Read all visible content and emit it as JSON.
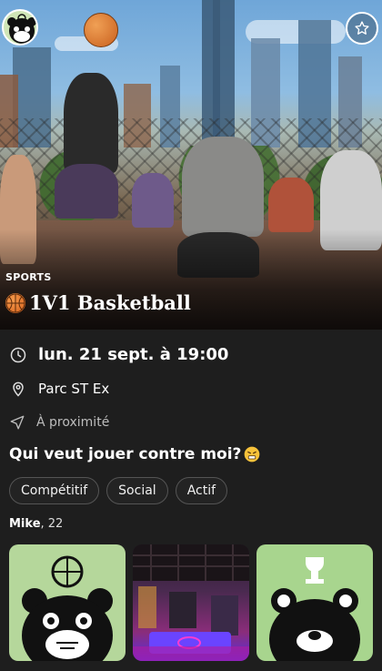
{
  "event": {
    "category": "SPORTS",
    "title": "1V1 Basketball",
    "date": "lun. 21 sept. à 19:00",
    "location": "Parc ST Ex",
    "proximity": "À proximité",
    "question": "Qui veut jouer contre moi?",
    "tags": [
      "Compétitif",
      "Social",
      "Actif"
    ]
  },
  "host": {
    "name": "Mike",
    "age": ", 22"
  },
  "icons": {
    "avatar": "bear-avatar-icon",
    "favorite": "star-icon",
    "date": "clock-icon",
    "location": "map-pin-icon",
    "proximity": "navigation-arrow-icon",
    "title_emoji": "basketball-icon",
    "question_emoji": "frustrated-face-icon"
  },
  "colors": {
    "background": "#1e1e1e",
    "tag_border": "#555555",
    "muted_text": "#bdbdbd"
  }
}
